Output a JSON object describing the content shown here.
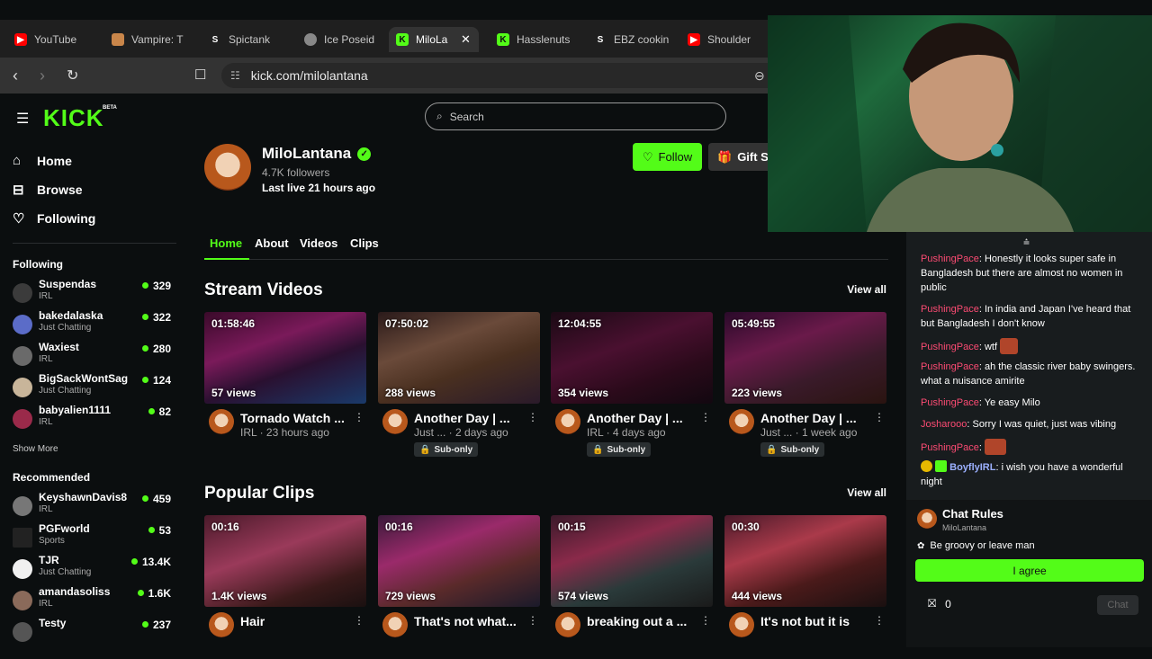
{
  "tabs": [
    {
      "title": "YouTube",
      "icon": "youtube-icon",
      "color": "#ff0000"
    },
    {
      "title": "Vampire: T",
      "icon": "vampire-icon",
      "color": "#c9864a"
    },
    {
      "title": "Spictank",
      "icon": "s-icon",
      "color": "#1f1f1f"
    },
    {
      "title": "Ice Poseid",
      "icon": "globe-icon",
      "color": "#888888"
    },
    {
      "title": "MiloLa",
      "icon": "kick-icon",
      "color": "#53fc18"
    },
    {
      "title": "Hasslenuts",
      "icon": "kick-icon",
      "color": "#53fc18"
    },
    {
      "title": "EBZ cookin",
      "icon": "s-icon",
      "color": "#1f1f1f"
    },
    {
      "title": "Shoulder",
      "icon": "youtube-icon",
      "color": "#ff0000"
    }
  ],
  "url": "kick.com/milolantana",
  "brand": {
    "logo": "KICK",
    "beta": "BETA",
    "accent": "#53fc18"
  },
  "search": {
    "placeholder": "Search"
  },
  "nav": {
    "home": "Home",
    "browse": "Browse",
    "following": "Following"
  },
  "following": {
    "heading": "Following",
    "channels": [
      {
        "name": "Suspendas",
        "category": "IRL",
        "viewers": "329"
      },
      {
        "name": "bakedalaska",
        "category": "Just Chatting",
        "viewers": "322"
      },
      {
        "name": "Waxiest",
        "category": "IRL",
        "viewers": "280"
      },
      {
        "name": "BigSackWontSag",
        "category": "Just Chatting",
        "viewers": "124"
      },
      {
        "name": "babyalien1111",
        "category": "IRL",
        "viewers": "82"
      }
    ],
    "show_more": "Show More"
  },
  "recommended": {
    "heading": "Recommended",
    "channels": [
      {
        "name": "KeyshawnDavis8",
        "category": "IRL",
        "viewers": "459"
      },
      {
        "name": "PGFworld",
        "category": "Sports",
        "viewers": "53"
      },
      {
        "name": "TJR",
        "category": "Just Chatting",
        "viewers": "13.4K"
      },
      {
        "name": "amandasoliss",
        "category": "IRL",
        "viewers": "1.6K"
      },
      {
        "name": "Testy",
        "category": "",
        "viewers": "237"
      }
    ]
  },
  "profile": {
    "name": "MiloLantana",
    "followers": "4.7K followers",
    "last_live": "Last live 21 hours ago",
    "follow": "Follow",
    "gift": "Gift Su"
  },
  "profile_tabs": [
    "Home",
    "About",
    "Videos",
    "Clips"
  ],
  "stream_videos": {
    "title": "Stream Videos",
    "view_all": "View all",
    "items": [
      {
        "duration": "01:58:46",
        "views": "57 views",
        "title": "Tornado Watch ...",
        "meta": "IRL · 23 hours ago",
        "sub": ""
      },
      {
        "duration": "07:50:02",
        "views": "288 views",
        "title": "Another Day | ...",
        "meta": "Just ... · 2 days ago",
        "sub": "Sub-only"
      },
      {
        "duration": "12:04:55",
        "views": "354 views",
        "title": "Another Day | ...",
        "meta": "IRL · 4 days ago",
        "sub": "Sub-only"
      },
      {
        "duration": "05:49:55",
        "views": "223 views",
        "title": "Another Day | ...",
        "meta": "Just ... · 1 week ago",
        "sub": "Sub-only"
      }
    ]
  },
  "popular_clips": {
    "title": "Popular Clips",
    "view_all": "View all",
    "items": [
      {
        "duration": "00:16",
        "views": "1.4K views",
        "title": "Hair"
      },
      {
        "duration": "00:16",
        "views": "729 views",
        "title": "That's not what..."
      },
      {
        "duration": "00:15",
        "views": "574 views",
        "title": "breaking out a ..."
      },
      {
        "duration": "00:30",
        "views": "444 views",
        "title": "It's not but it is"
      }
    ]
  },
  "chat": {
    "messages": [
      {
        "user": "PushingPace",
        "text": "Honestly it looks super safe in Bangladesh but there are almost no women in public"
      },
      {
        "user": "PushingPace",
        "text": "In india and Japan I've heard that but Bangladesh I don't know"
      },
      {
        "user": "PushingPace",
        "text": "wtf"
      },
      {
        "user": "PushingPace",
        "text": "ah the classic river baby swingers. what a nuisance amirite"
      },
      {
        "user": "PushingPace",
        "text": "Ye easy Milo"
      },
      {
        "user": "Josharooo",
        "text": "Sorry I was quiet, just was vibing"
      },
      {
        "user": "PushingPace",
        "text": ""
      },
      {
        "user": "BoyflyIRL",
        "text": "i wish you have a wonderful night"
      }
    ],
    "rules_title": "Chat Rules",
    "rules_owner": "MiloLantana",
    "rule": "Be groovy or leave man",
    "agree": "I agree",
    "count": "0",
    "send": "Chat"
  }
}
